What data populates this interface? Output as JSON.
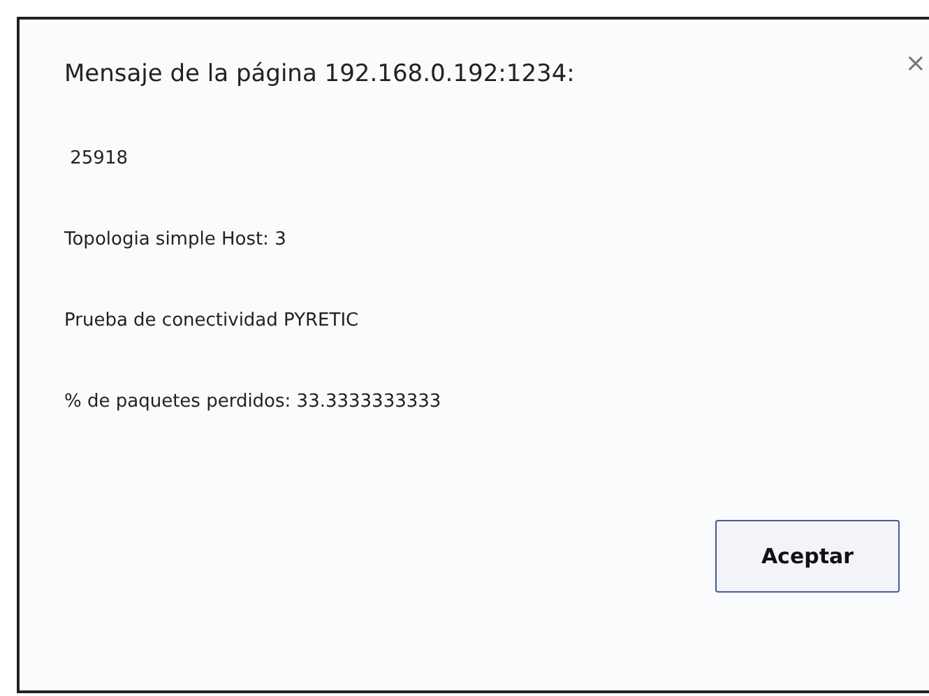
{
  "dialog": {
    "title": "Mensaje de la página 192.168.0.192:1234:",
    "close": "×",
    "lines": [
      " 25918",
      "Topologia simple Host: 3",
      "Prueba de conectividad PYRETIC",
      "% de paquetes perdidos: 33.3333333333"
    ],
    "buttons": [
      "Aceptar"
    ]
  }
}
